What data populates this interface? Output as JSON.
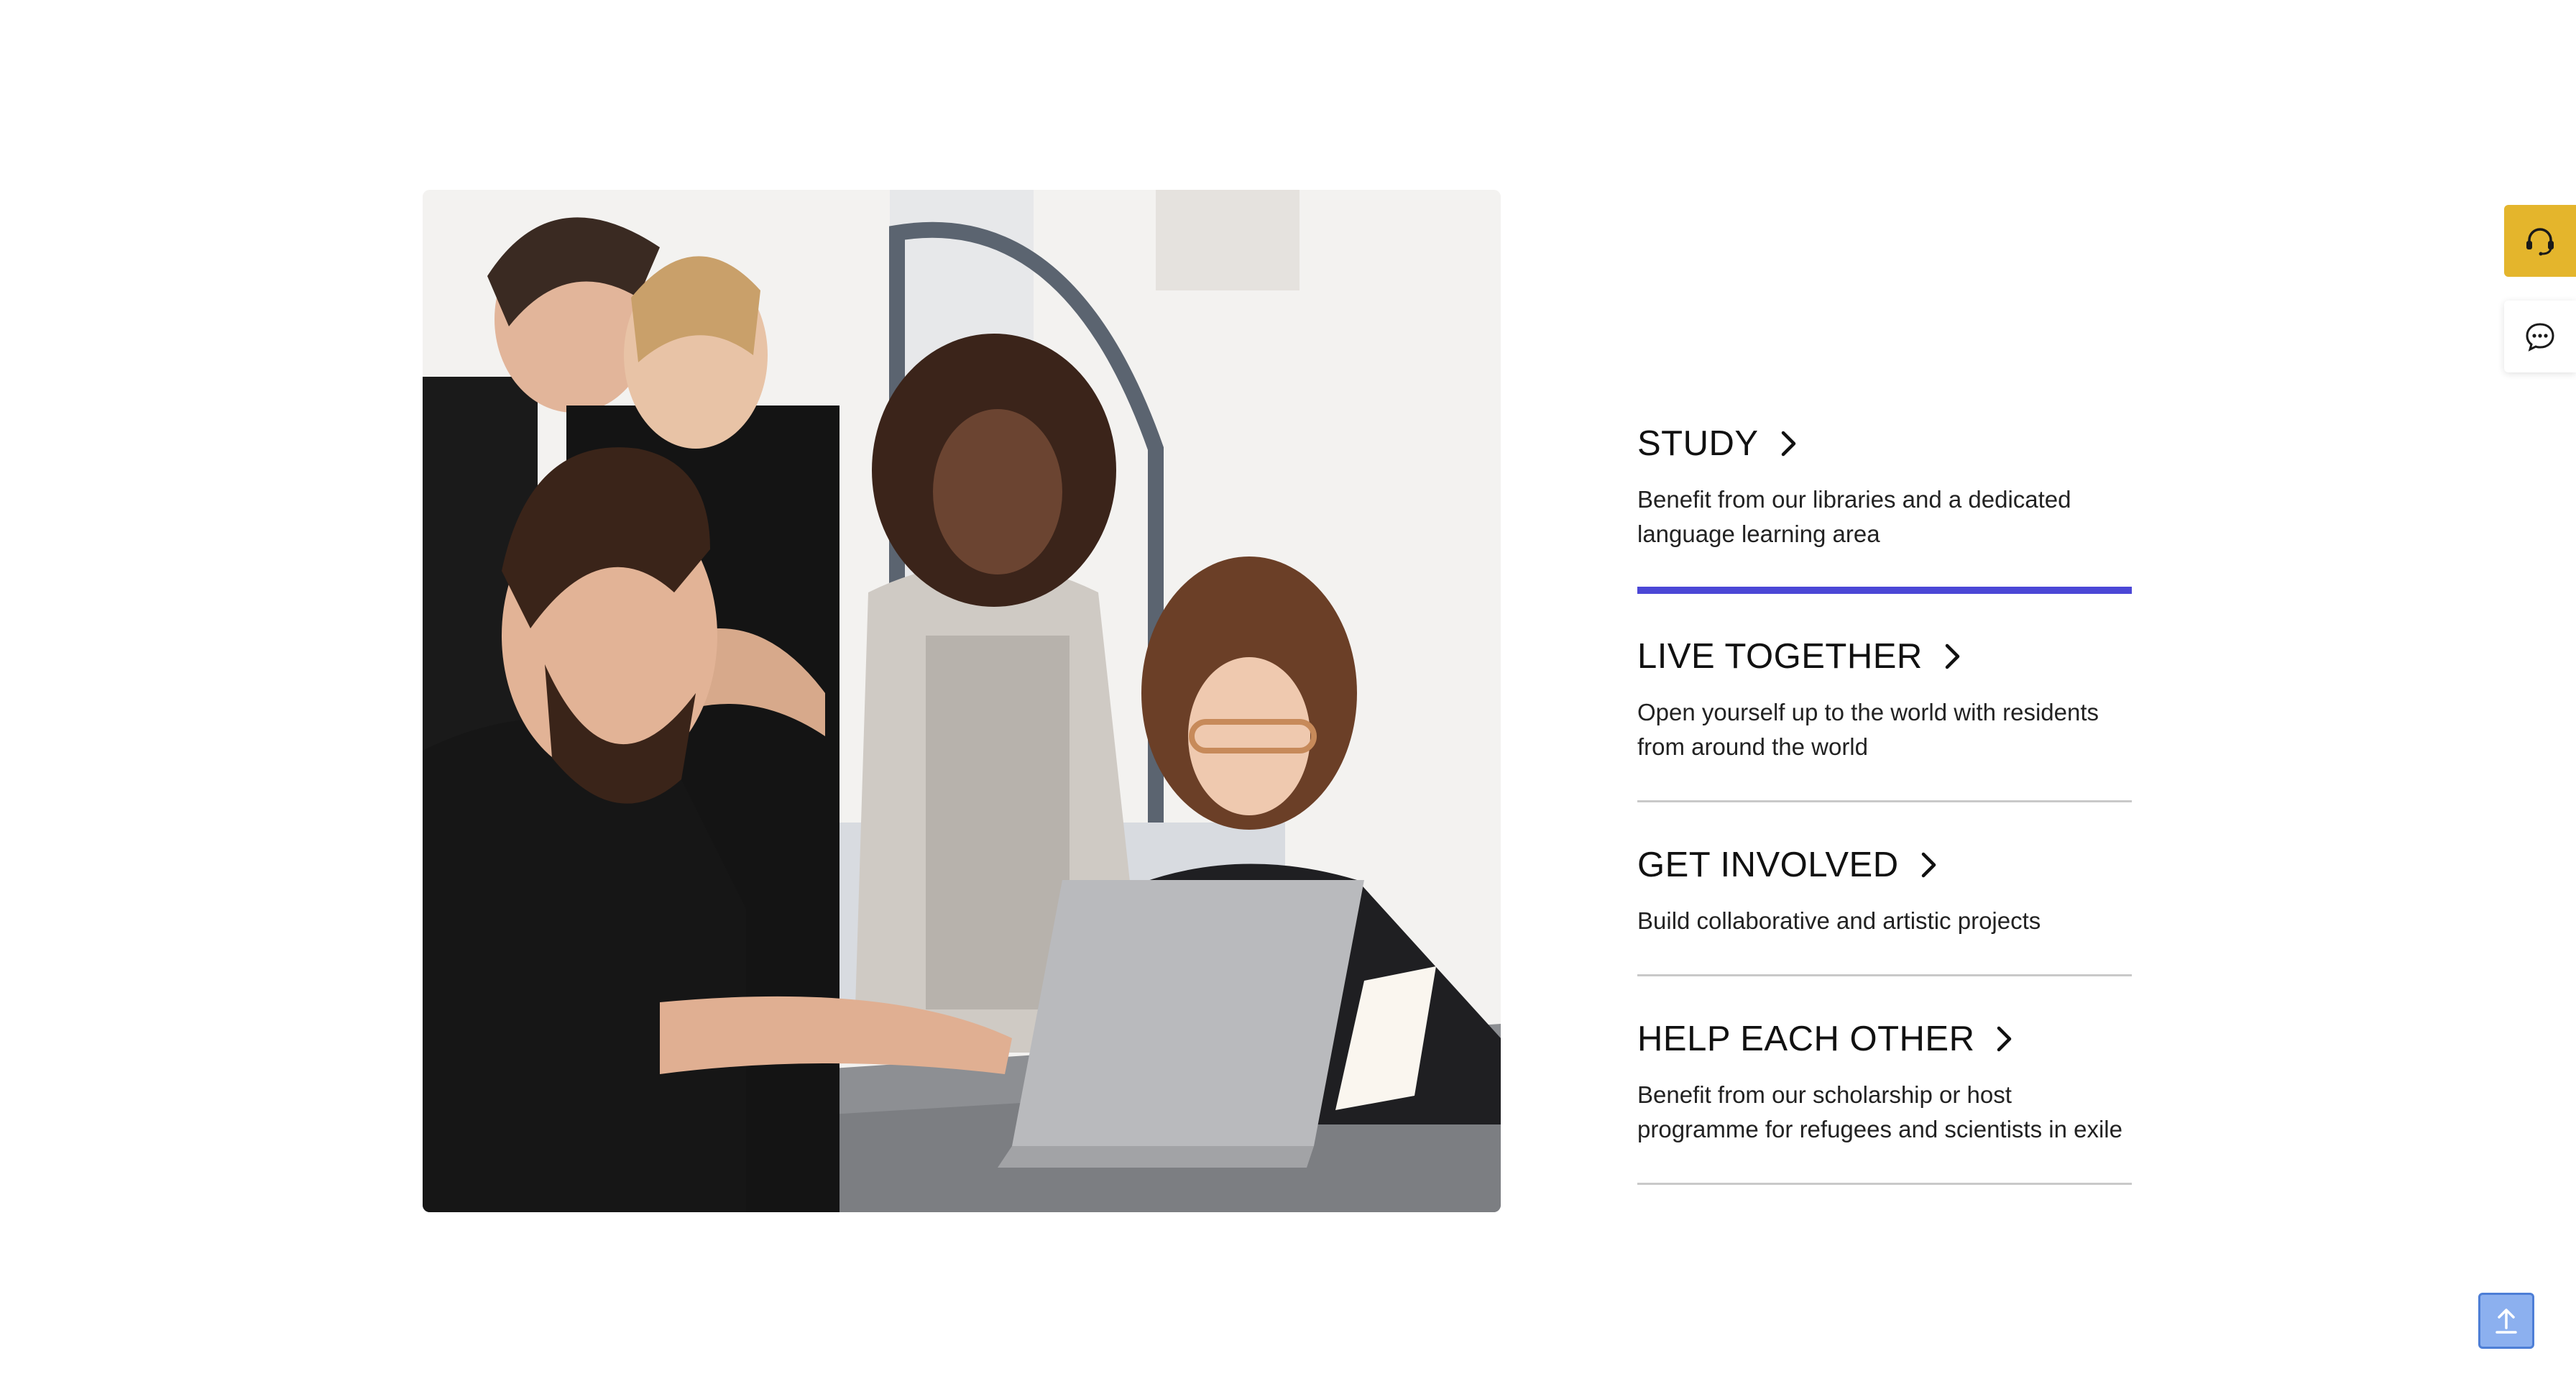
{
  "hero_image": {
    "alt": "Group of young people smiling and looking at a laptop",
    "icon": "photo-image"
  },
  "features": [
    {
      "title": "STUDY",
      "description": "Benefit from our libraries and a dedicated language learning area",
      "active": true
    },
    {
      "title": "LIVE TOGETHER",
      "description": "Open yourself up to the world with residents from around the world",
      "active": false
    },
    {
      "title": "GET INVOLVED",
      "description": "Build collaborative and artistic projects",
      "active": false
    },
    {
      "title": "HELP EACH OTHER",
      "description": "Benefit from our scholarship or host programme for refugees and scientists in exile",
      "active": false
    }
  ],
  "side_tabs": {
    "support_icon": "headset-icon",
    "chat_icon": "chat-bubble-icon"
  },
  "back_to_top_icon": "arrow-up-icon",
  "colors": {
    "accent": "#4b47d6",
    "support_tab": "#e4b52c",
    "back_to_top": "#8cb0ef",
    "divider": "#c9c9c9"
  }
}
